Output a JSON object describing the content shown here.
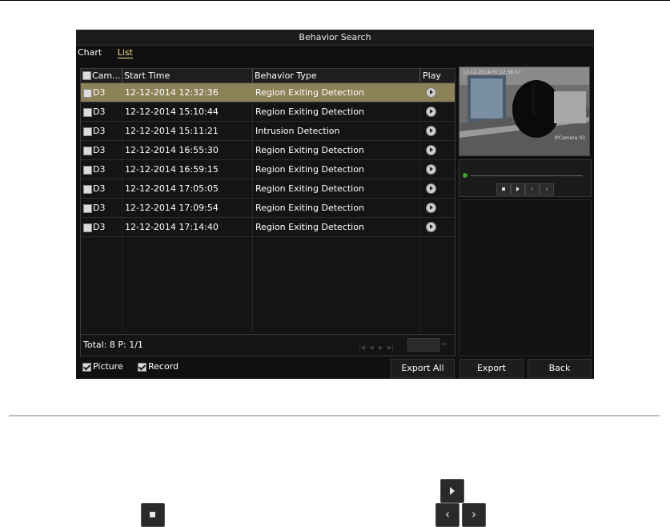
{
  "window": {
    "title": "Behavior Search"
  },
  "tabs": [
    {
      "label": "Chart",
      "active": false
    },
    {
      "label": "List",
      "active": true
    }
  ],
  "table": {
    "headers": {
      "camera": "Cam...",
      "start_time": "Start Time",
      "behavior_type": "Behavior Type",
      "play": "Play"
    },
    "rows": [
      {
        "camera": "D3",
        "start_time": "12-12-2014 12:32:36",
        "behavior_type": "Region Exiting Detection",
        "selected": true
      },
      {
        "camera": "D3",
        "start_time": "12-12-2014 15:10:44",
        "behavior_type": "Region Exiting Detection",
        "selected": false
      },
      {
        "camera": "D3",
        "start_time": "12-12-2014 15:11:21",
        "behavior_type": "Intrusion Detection",
        "selected": false
      },
      {
        "camera": "D3",
        "start_time": "12-12-2014 16:55:30",
        "behavior_type": "Region Exiting Detection",
        "selected": false
      },
      {
        "camera": "D3",
        "start_time": "12-12-2014 16:59:15",
        "behavior_type": "Region Exiting Detection",
        "selected": false
      },
      {
        "camera": "D3",
        "start_time": "12-12-2014 17:05:05",
        "behavior_type": "Region Exiting Detection",
        "selected": false
      },
      {
        "camera": "D3",
        "start_time": "12-12-2014 17:09:54",
        "behavior_type": "Region Exiting Detection",
        "selected": false
      },
      {
        "camera": "D3",
        "start_time": "12-12-2014 17:14:40",
        "behavior_type": "Region Exiting Detection",
        "selected": false
      }
    ],
    "total_text": "Total: 8  P: 1/1"
  },
  "preview": {
    "timestamp": "12-12-2014 Fri 12:38:57",
    "camera_label": "IPCamera 03"
  },
  "options": [
    {
      "label": "Picture",
      "checked": true
    },
    {
      "label": "Record",
      "checked": true
    }
  ],
  "buttons": {
    "export_all": "Export All",
    "export": "Export",
    "back": "Back"
  },
  "colors": {
    "selected_row": "#8c8157",
    "active_tab": "#f0e08a",
    "background": "#101010"
  }
}
